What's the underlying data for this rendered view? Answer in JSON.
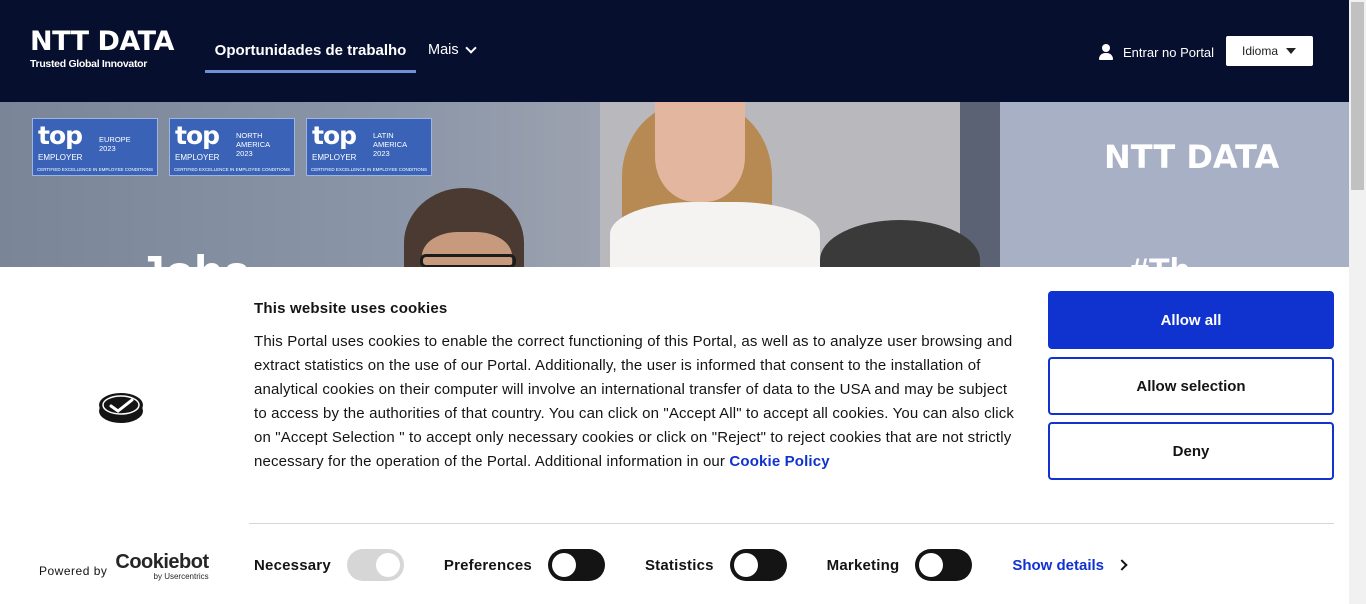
{
  "header": {
    "logo_main": "NTT DATA",
    "logo_sub": "Trusted Global Innovator",
    "nav_active": "Oportunidades de trabalho",
    "nav_more": "Mais",
    "login": "Entrar no Portal",
    "language": "Idioma"
  },
  "hero": {
    "badges": [
      {
        "top": "top",
        "employer": "EMPLOYER",
        "region": "EUROPE",
        "year": "2023",
        "footer": "CERTIFIED EXCELLENCE IN EMPLOYEE CONDITIONS"
      },
      {
        "top": "top",
        "employer": "EMPLOYER",
        "region": "NORTH AMERICA",
        "year": "2023",
        "footer": "CERTIFIED EXCELLENCE IN EMPLOYEE CONDITIONS"
      },
      {
        "top": "top",
        "employer": "EMPLOYER",
        "region": "LATIN AMERICA",
        "year": "2023",
        "footer": "CERTIFIED EXCELLENCE IN EMPLOYEE CONDITIONS"
      }
    ],
    "logo": "NTT DATA",
    "big_text": "Jobs",
    "hash_text": "#Th"
  },
  "cookie": {
    "title": "This website uses cookies",
    "body": "This Portal uses cookies to enable the correct functioning of this Portal, as well as to analyze user browsing and extract statistics on the use of our Portal. Additionally, the user is informed that consent to the installation of analytical cookies on their computer will involve an international transfer of data to the USA and may be subject to access by the authorities of that country. You can click on \"Accept All\" to accept all cookies. You can also click on \"Accept Selection \" to accept only necessary cookies or click on \"Reject\" to reject cookies that are not strictly necessary for the operation of the Portal. Additional information in our",
    "link": "Cookie Policy",
    "buttons": {
      "allow_all": "Allow all",
      "allow_selection": "Allow selection",
      "deny": "Deny"
    },
    "powered_by": "Powered by",
    "brand": "Cookiebot",
    "brand_sub": "by Usercentrics",
    "toggles": {
      "necessary": "Necessary",
      "preferences": "Preferences",
      "statistics": "Statistics",
      "marketing": "Marketing"
    },
    "show_details": "Show details"
  }
}
